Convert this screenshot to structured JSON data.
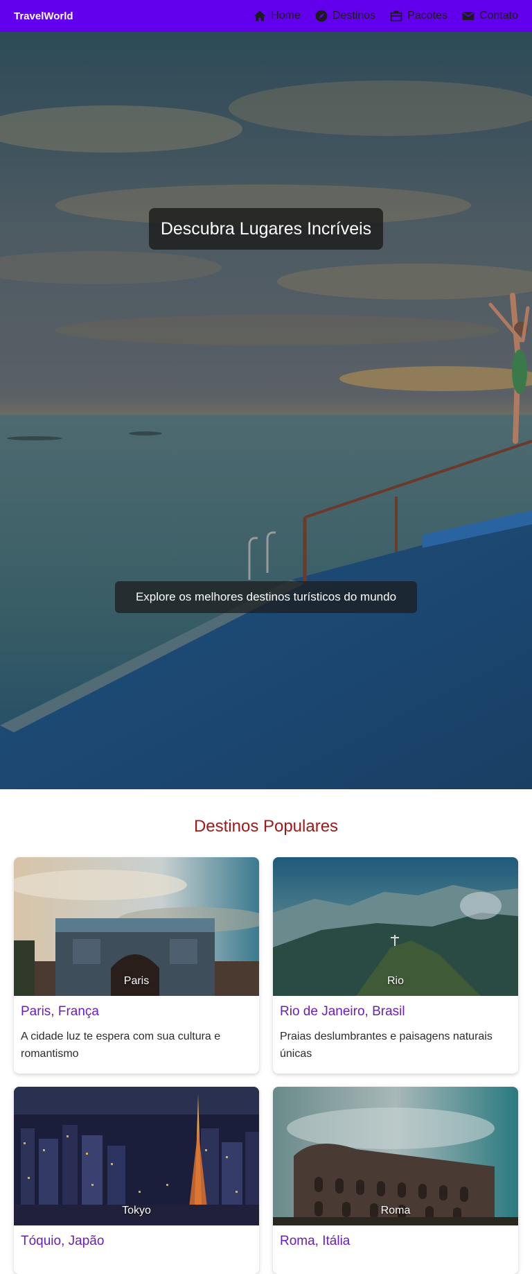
{
  "navbar": {
    "brand": "TravelWorld",
    "items": [
      {
        "label": "Home",
        "icon": "home-icon"
      },
      {
        "label": "Destinos",
        "icon": "compass-icon"
      },
      {
        "label": "Pacotes",
        "icon": "briefcase-icon"
      },
      {
        "label": "Contato",
        "icon": "mail-icon"
      }
    ]
  },
  "hero": {
    "title": "Descubra Lugares Incríveis",
    "subtitle": "Explore os melhores destinos turísticos do mundo"
  },
  "destinations": {
    "title": "Destinos Populares",
    "cards": [
      {
        "image_label": "Paris",
        "title": "Paris, França",
        "description": "A cidade luz te espera com sua cultura e romantismo"
      },
      {
        "image_label": "Rio",
        "title": "Rio de Janeiro, Brasil",
        "description": "Praias deslumbrantes e paisagens naturais únicas"
      },
      {
        "image_label": "Tokyo",
        "title": "Tóquio, Japão",
        "description": ""
      },
      {
        "image_label": "Roma",
        "title": "Roma, Itália",
        "description": ""
      }
    ]
  },
  "colors": {
    "navbar_bg": "#6200ee",
    "section_title": "#a01818",
    "card_title": "#6a1fb8"
  }
}
